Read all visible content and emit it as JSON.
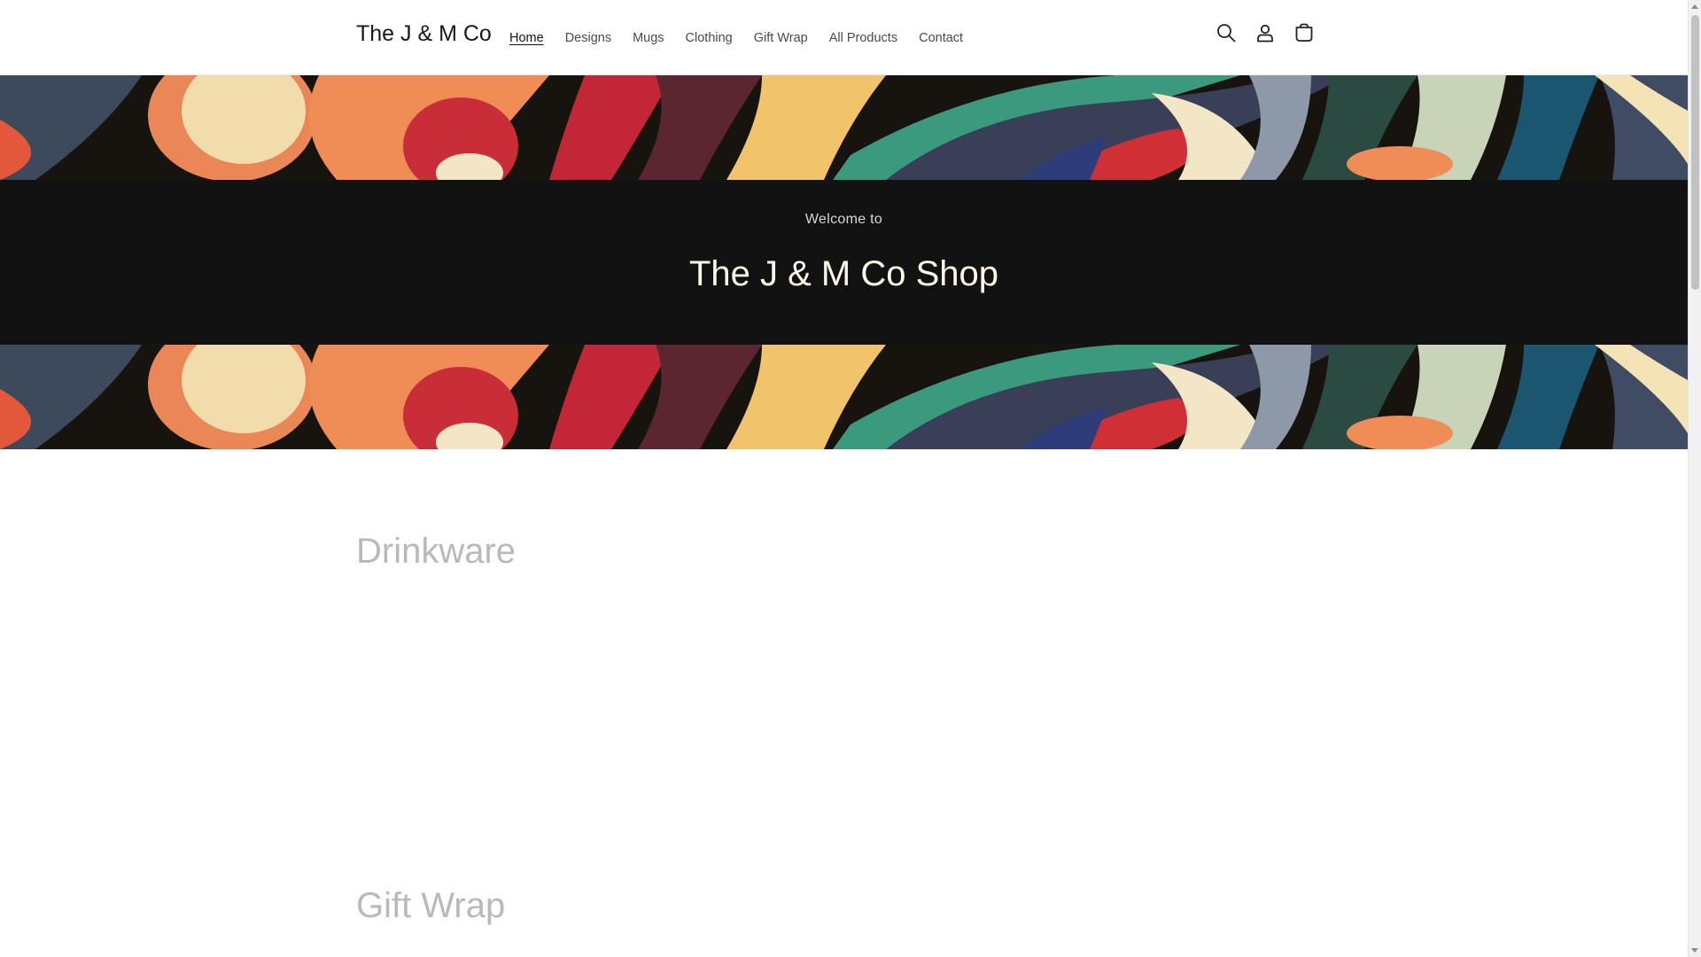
{
  "header": {
    "logo": "The J & M Co",
    "nav": [
      {
        "label": "Home",
        "active": true
      },
      {
        "label": "Designs",
        "active": false
      },
      {
        "label": "Mugs",
        "active": false
      },
      {
        "label": "Clothing",
        "active": false
      },
      {
        "label": "Gift Wrap",
        "active": false
      },
      {
        "label": "All Products",
        "active": false
      },
      {
        "label": "Contact",
        "active": false
      }
    ],
    "icons": [
      "search-icon",
      "account-icon",
      "cart-icon"
    ]
  },
  "hero": {
    "subtitle": "Welcome to",
    "title": "The J & M Co Shop"
  },
  "sections": {
    "drinkware_title": "Drinkware",
    "giftwrap_title": "Gift Wrap"
  },
  "colors": {
    "hero_bg": "#121212",
    "hero_title": "#fff9ea",
    "section_heading": "#b9b9b9"
  }
}
